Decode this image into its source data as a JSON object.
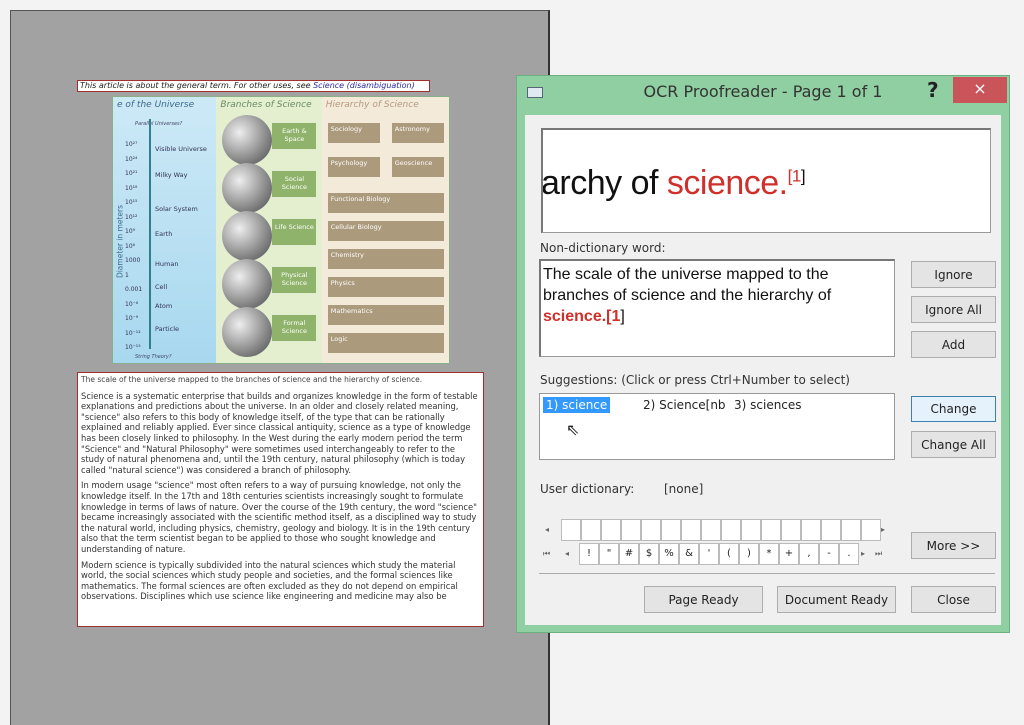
{
  "document": {
    "header_text": "This article is about the general term. For other uses, see ",
    "header_link": "Science (disambiguation)",
    "figure": {
      "col_titles": [
        "e of the Universe",
        "Branches of Science",
        "Hierarchy of Science"
      ],
      "top_note": "Parallel Universes?",
      "bottom_note": "String Theory?",
      "axis_label": "Diameter in meters",
      "scale_values": [
        "10²⁷",
        "10²⁴",
        "10²¹",
        "10¹⁸",
        "10¹⁵",
        "10¹²",
        "10⁹",
        "10⁶",
        "1000",
        "1",
        "0.001",
        "10⁻⁶",
        "10⁻⁹",
        "10⁻¹²",
        "10⁻¹⁵"
      ],
      "scale_labels": [
        "Visible Universe",
        "Milky Way",
        "Solar System",
        "Earth",
        "Human",
        "Cell",
        "Atom",
        "Particle"
      ],
      "branches": [
        "Earth & Space",
        "Social Science",
        "Life Science",
        "Physical Science",
        "Formal Science"
      ],
      "hierarchy": [
        "Sociology",
        "Astronomy",
        "Psychology",
        "Geoscience",
        "Functional Biology",
        "Cellular Biology",
        "Chemistry",
        "Physics",
        "Mathematics",
        "Logic"
      ]
    },
    "caption": "The scale of the universe mapped to the branches of science and the hierarchy of science.",
    "paragraphs": [
      "Science is a systematic enterprise that builds and organizes knowledge in the form of testable explanations and predictions about the universe. In an older and closely related meaning, \"science\" also refers to this body of knowledge itself, of the type that can be rationally explained and reliably applied. Ever since classical antiquity, science as a type of knowledge has been closely linked to philosophy. In the West during the early modern period the term \"Science\" and \"Natural Philosophy\" were sometimes used interchangeably to refer to the study of natural phenomena and, until the 19th century, natural philosophy (which is today called \"natural science\") was considered a branch of philosophy.",
      "In modern usage \"science\" most often refers to a way of pursuing knowledge, not only the knowledge itself. In the 17th and 18th centuries scientists increasingly sought to formulate knowledge in terms of laws of nature. Over the course of the 19th century, the word \"science\" became increasingly associated with the scientific method itself, as a disciplined way to study the natural world, including physics, chemistry, geology and biology. It is in the 19th century also that the term scientist began to be applied to those who sought knowledge and understanding of nature.",
      "Modern science is typically subdivided into the natural sciences which study the material world, the social sciences which study people and societies, and the formal sciences like mathematics. The formal sciences are often excluded as they do not depend on empirical observations. Disciplines which use science like engineering and medicine may also be"
    ]
  },
  "dialog": {
    "title": "OCR Proofreader - Page 1 of 1",
    "help": "?",
    "close": "×",
    "preview": {
      "before": "archy of ",
      "word": "science.",
      "ref": "[1",
      "after": "]"
    },
    "ndw_label": "Non-dictionary word:",
    "ndw_text": "The scale of the universe mapped to the branches of science and the hierarchy of ",
    "ndw_word": "science.[1",
    "ndw_after": "]",
    "buttons": {
      "ignore": "Ignore",
      "ignore_all": "Ignore All",
      "add": "Add",
      "change": "Change",
      "change_all": "Change All",
      "more": "More >>",
      "page_ready": "Page Ready",
      "document_ready": "Document Ready",
      "close": "Close"
    },
    "suggestions_label": "Suggestions: (Click or press Ctrl+Number to select)",
    "suggestions": [
      "1) science",
      "2) Science[nb",
      "3) sciences"
    ],
    "user_dict_label": "User dictionary:",
    "user_dict_value": "[none]",
    "special_chars": [
      "!",
      "\"",
      "#",
      "$",
      "%",
      "&",
      "'",
      "(",
      ")",
      "*",
      "+",
      ",",
      "-",
      "."
    ],
    "colors": {
      "frame": "#8fcfa1",
      "close": "#c9545a",
      "highlight": "#d0302a",
      "selection": "#3399ff"
    }
  }
}
